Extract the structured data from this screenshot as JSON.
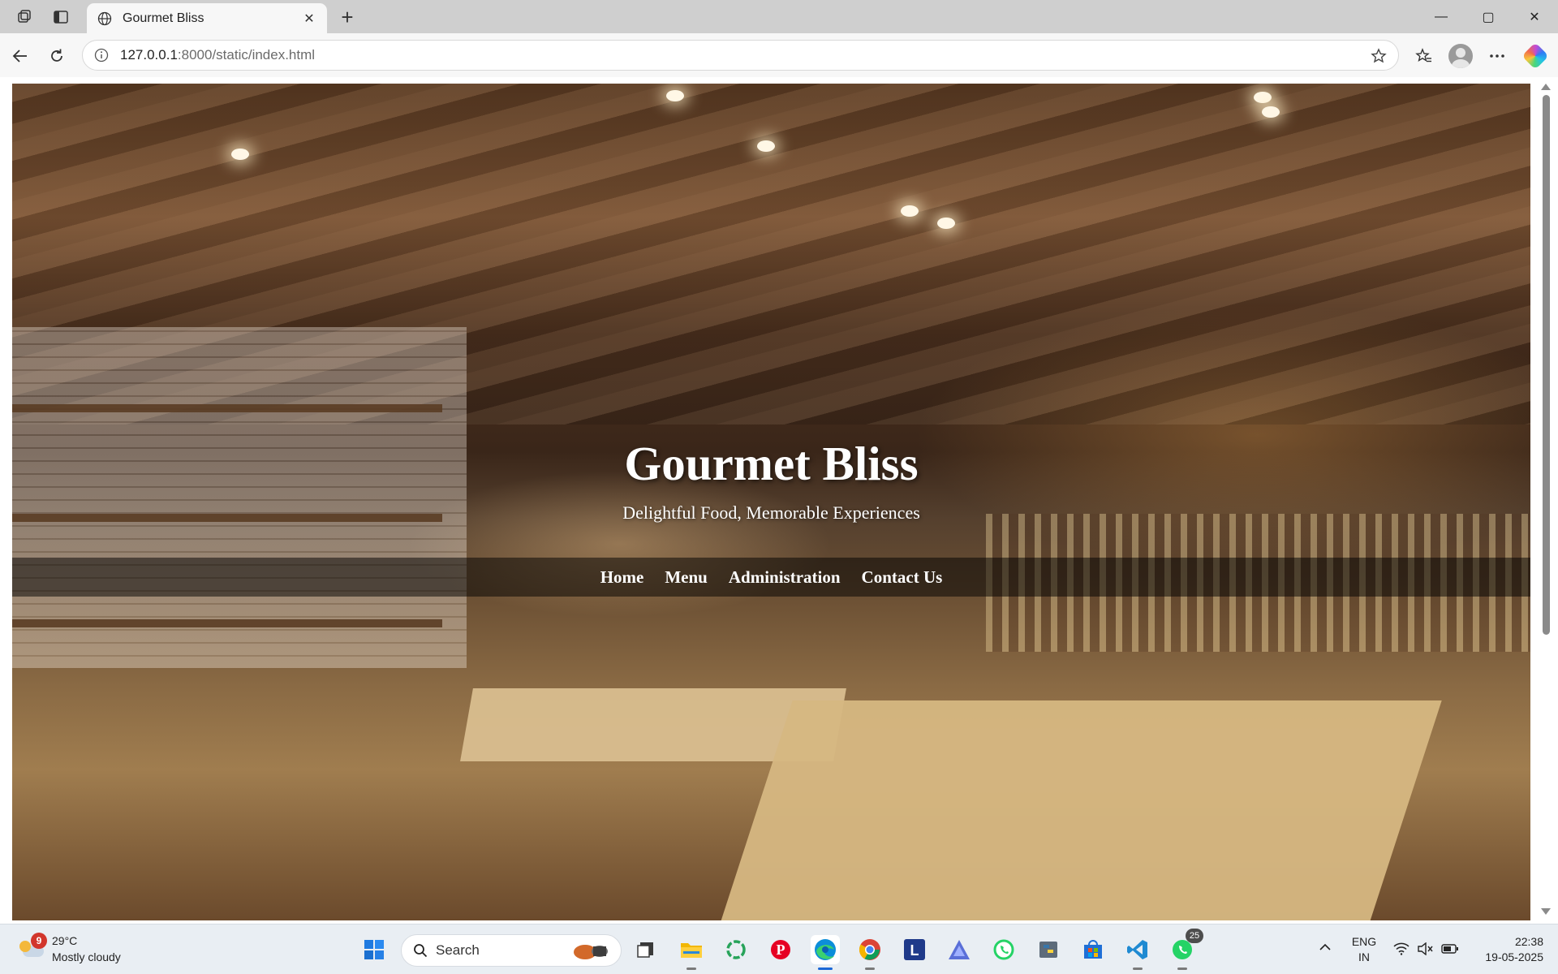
{
  "browser": {
    "tab": {
      "title": "Gourmet Bliss",
      "close_glyph": "✕"
    },
    "new_tab_glyph": "+",
    "window_controls": {
      "minimize": "—",
      "maximize": "▢",
      "close": "✕"
    },
    "address": {
      "host": "127.0.0.1",
      "path": ":8000/static/index.html"
    },
    "icons": [
      "workspaces-icon",
      "vertical-tabs-icon",
      "globe-icon",
      "back-arrow-icon",
      "refresh-icon",
      "site-info-icon",
      "favorite-star-icon",
      "favorites-icon",
      "profile-icon",
      "more-options-icon",
      "copilot-icon"
    ]
  },
  "page": {
    "title": "Gourmet Bliss",
    "subtitle": "Delightful Food, Memorable Experiences",
    "nav": [
      {
        "label": "Home"
      },
      {
        "label": "Menu"
      },
      {
        "label": "Administration"
      },
      {
        "label": "Contact Us"
      }
    ]
  },
  "taskbar": {
    "weather": {
      "badge": "9",
      "temp": "29°C",
      "condition": "Mostly cloudy"
    },
    "search_label": "Search",
    "whatsapp_badge": "25",
    "language": {
      "line1": "ENG",
      "line2": "IN"
    },
    "clock": {
      "time": "22:38",
      "date": "19-05-2025"
    },
    "tray_chevron": "^"
  },
  "colors": {
    "nav_overlay": "rgba(0,0,0,0.5)",
    "accent_edge": "#1b67d6",
    "hero_text": "#ffffff"
  }
}
